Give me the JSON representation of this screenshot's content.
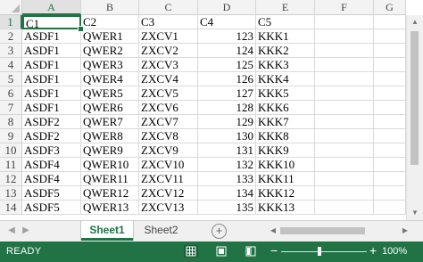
{
  "columns": [
    "A",
    "B",
    "C",
    "D",
    "E",
    "F",
    "G"
  ],
  "selected_cell": "A1",
  "rows": [
    {
      "num": "1",
      "cells": [
        "C1",
        "C2",
        "C3",
        "C4",
        "C5"
      ]
    },
    {
      "num": "2",
      "cells": [
        "ASDF1",
        "QWER1",
        "ZXCV1",
        "123",
        "KKK1"
      ]
    },
    {
      "num": "3",
      "cells": [
        "ASDF1",
        "QWER2",
        "ZXCV2",
        "124",
        "KKK2"
      ]
    },
    {
      "num": "4",
      "cells": [
        "ASDF1",
        "QWER3",
        "ZXCV3",
        "125",
        "KKK3"
      ]
    },
    {
      "num": "5",
      "cells": [
        "ASDF1",
        "QWER4",
        "ZXCV4",
        "126",
        "KKK4"
      ]
    },
    {
      "num": "6",
      "cells": [
        "ASDF1",
        "QWER5",
        "ZXCV5",
        "127",
        "KKK5"
      ]
    },
    {
      "num": "7",
      "cells": [
        "ASDF1",
        "QWER6",
        "ZXCV6",
        "128",
        "KKK6"
      ]
    },
    {
      "num": "8",
      "cells": [
        "ASDF2",
        "QWER7",
        "ZXCV7",
        "129",
        "KKK7"
      ]
    },
    {
      "num": "9",
      "cells": [
        "ASDF2",
        "QWER8",
        "ZXCV8",
        "130",
        "KKK8"
      ]
    },
    {
      "num": "10",
      "cells": [
        "ASDF3",
        "QWER9",
        "ZXCV9",
        "131",
        "KKK9"
      ]
    },
    {
      "num": "11",
      "cells": [
        "ASDF4",
        "QWER10",
        "ZXCV10",
        "132",
        "KKK10"
      ]
    },
    {
      "num": "12",
      "cells": [
        "ASDF4",
        "QWER11",
        "ZXCV11",
        "133",
        "KKK11"
      ]
    },
    {
      "num": "13",
      "cells": [
        "ASDF5",
        "QWER12",
        "ZXCV12",
        "134",
        "KKK12"
      ]
    },
    {
      "num": "14",
      "cells": [
        "ASDF5",
        "QWER13",
        "ZXCV13",
        "135",
        "KKK13"
      ]
    }
  ],
  "tabs": [
    {
      "label": "Sheet1",
      "active": true
    },
    {
      "label": "Sheet2",
      "active": false
    }
  ],
  "add_sheet_symbol": "+",
  "status": {
    "ready": "READY",
    "zoom_minus": "−",
    "zoom_plus": "+",
    "zoom_level": "100%"
  },
  "colors": {
    "accent": "#217346"
  }
}
